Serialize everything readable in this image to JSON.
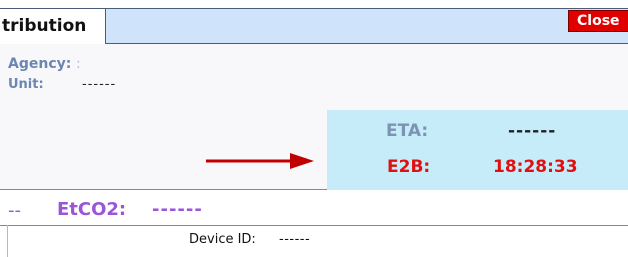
{
  "tab": {
    "label": "tribution"
  },
  "buttons": {
    "close": "Close"
  },
  "agency": {
    "label": "Agency:",
    "separator": ":"
  },
  "unit": {
    "label": "Unit:",
    "value": "------"
  },
  "eta": {
    "label": "ETA:",
    "value": "------"
  },
  "e2b": {
    "label": "E2B:",
    "value": "18:28:33"
  },
  "etco2": {
    "prefix": "--",
    "label": "EtCO2:",
    "value": "------"
  },
  "device": {
    "label": "Device ID:",
    "value": "------"
  },
  "colors": {
    "accent_blue": "#cfe3fb",
    "eta_panel": "#c6ecfa",
    "alert_red": "#e01010",
    "close_red": "#e10000",
    "purple": "#9a55d8",
    "arrow_red": "#c00000"
  },
  "icons": {
    "arrow": "right-arrow-icon"
  }
}
